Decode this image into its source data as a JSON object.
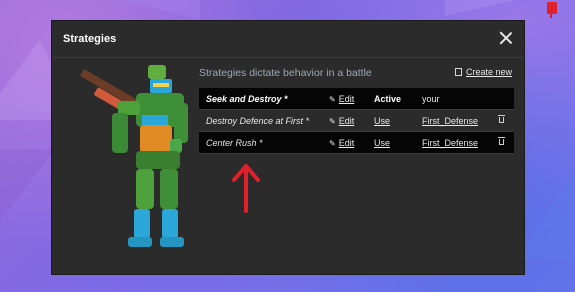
{
  "dialog": {
    "title": "Strategies",
    "description": "Strategies dictate behavior in a battle",
    "create_new_label": "Create new",
    "rows": [
      {
        "name": "Seek and Destroy *",
        "edit_label": "Edit",
        "status": "Active",
        "control": "your"
      },
      {
        "name": "Destroy Defence at First *",
        "edit_label": "Edit",
        "status": "Use",
        "control": "First_Defense"
      },
      {
        "name": "Center Rush *",
        "edit_label": "Edit",
        "status": "Use",
        "control": "First_Defense"
      }
    ]
  },
  "icons": {
    "close": "close-icon",
    "create_new": "document-icon",
    "edit": "pencil-icon",
    "delete": "trash-icon",
    "annotation": "red-arrow-up",
    "corner": "red-flag-icon"
  },
  "colors": {
    "dialog_bg": "#2b2b2b",
    "row_dark": "#050505",
    "description_text": "#9aa9b9",
    "arrow": "#e0202a"
  }
}
